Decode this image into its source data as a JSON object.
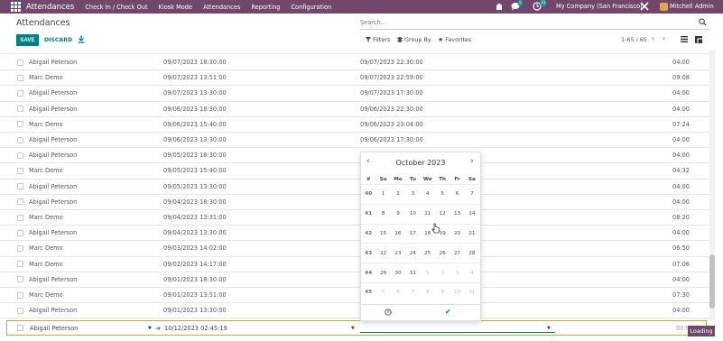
{
  "navbar": {
    "app_title": "Attendances",
    "menu": [
      "Check In / Check Out",
      "Kiosk Mode",
      "Attendances",
      "Reporting",
      "Configuration"
    ],
    "chat_count": "5",
    "activity_count": "31",
    "company": "My Company (San Francisco)",
    "user": "Mitchell Admin"
  },
  "control": {
    "breadcrumb": "Attendances",
    "search_placeholder": "Search...",
    "save_label": "SAVE",
    "discard_label": "DISCARD",
    "filters_label": "Filters",
    "group_by_label": "Group By",
    "favorites_label": "Favorites",
    "pager": "1-65 / 65"
  },
  "rows": [
    {
      "employee": "Abigail Peterson",
      "check_in": "09/07/2023 18:30:00",
      "check_out": "09/07/2023 22:30:00",
      "hours": "04:00"
    },
    {
      "employee": "Marc Demo",
      "check_in": "09/07/2023 13:51:00",
      "check_out": "09/07/2023 22:59:00",
      "hours": "09:08"
    },
    {
      "employee": "Abigail Peterson",
      "check_in": "09/07/2023 13:30:00",
      "check_out": "09/07/2023 17:30:00",
      "hours": "04:00"
    },
    {
      "employee": "Abigail Peterson",
      "check_in": "09/06/2023 18:30:00",
      "check_out": "09/06/2023 22:30:00",
      "hours": "04:00"
    },
    {
      "employee": "Marc Demo",
      "check_in": "09/06/2023 15:40:00",
      "check_out": "09/06/2023 23:04:00",
      "hours": "07:24"
    },
    {
      "employee": "Abigail Peterson",
      "check_in": "09/06/2023 13:30:00",
      "check_out": "09/06/2023 17:30:00",
      "hours": "04:00"
    },
    {
      "employee": "Abigail Peterson",
      "check_in": "09/05/2023 18:30:00",
      "check_out": "",
      "hours": "04:00"
    },
    {
      "employee": "Marc Demo",
      "check_in": "09/05/2023 15:40:00",
      "check_out": "",
      "hours": "04:32"
    },
    {
      "employee": "Abigail Peterson",
      "check_in": "09/05/2023 13:30:00",
      "check_out": "",
      "hours": "04:00"
    },
    {
      "employee": "Abigail Peterson",
      "check_in": "09/04/2023 18:30:00",
      "check_out": "",
      "hours": "04:00"
    },
    {
      "employee": "Marc Demo",
      "check_in": "09/04/2023 13:31:00",
      "check_out": "",
      "hours": "08:20"
    },
    {
      "employee": "Abigail Peterson",
      "check_in": "09/04/2023 13:30:00",
      "check_out": "",
      "hours": "04:00"
    },
    {
      "employee": "Marc Demo",
      "check_in": "09/03/2023 14:02:00",
      "check_out": "",
      "hours": "06:50"
    },
    {
      "employee": "Marc Demo",
      "check_in": "09/02/2023 14:17:00",
      "check_out": "",
      "hours": "07:06"
    },
    {
      "employee": "Abigail Peterson",
      "check_in": "09/01/2023 18:30:00",
      "check_out": "",
      "hours": "04:00"
    },
    {
      "employee": "Marc Demo",
      "check_in": "09/01/2023 13:51:00",
      "check_out": "",
      "hours": "07:30"
    },
    {
      "employee": "Abigail Peterson",
      "check_in": "09/01/2023 13:30:00",
      "check_out": "",
      "hours": "04:00"
    }
  ],
  "edit_row": {
    "employee": "Abigail Peterson",
    "check_in": "10/12/2023 02:45:19",
    "hours": "00:00",
    "loading": "Loading"
  },
  "datepicker": {
    "month_label": "October 2023",
    "week_header": "#",
    "days": [
      "Su",
      "Mo",
      "Tu",
      "We",
      "Th",
      "Fr",
      "Sa"
    ],
    "weeks": [
      {
        "wk": "40",
        "dates": [
          "1",
          "2",
          "3",
          "4",
          "5",
          "6",
          "7"
        ],
        "muted": [
          false,
          false,
          false,
          false,
          false,
          false,
          false
        ]
      },
      {
        "wk": "41",
        "dates": [
          "8",
          "9",
          "10",
          "11",
          "12",
          "13",
          "14"
        ],
        "muted": [
          false,
          false,
          false,
          false,
          false,
          false,
          false
        ]
      },
      {
        "wk": "42",
        "dates": [
          "15",
          "16",
          "17",
          "18",
          "19",
          "20",
          "21"
        ],
        "muted": [
          false,
          false,
          false,
          false,
          false,
          false,
          false
        ]
      },
      {
        "wk": "43",
        "dates": [
          "22",
          "23",
          "24",
          "25",
          "26",
          "27",
          "28"
        ],
        "muted": [
          false,
          false,
          false,
          false,
          false,
          false,
          false
        ]
      },
      {
        "wk": "44",
        "dates": [
          "29",
          "30",
          "31",
          "1",
          "2",
          "3",
          "4"
        ],
        "muted": [
          false,
          false,
          false,
          true,
          true,
          true,
          true
        ]
      },
      {
        "wk": "45",
        "dates": [
          "5",
          "6",
          "7",
          "8",
          "9",
          "10",
          "11"
        ],
        "muted": [
          true,
          true,
          true,
          true,
          true,
          true,
          true
        ]
      }
    ]
  }
}
